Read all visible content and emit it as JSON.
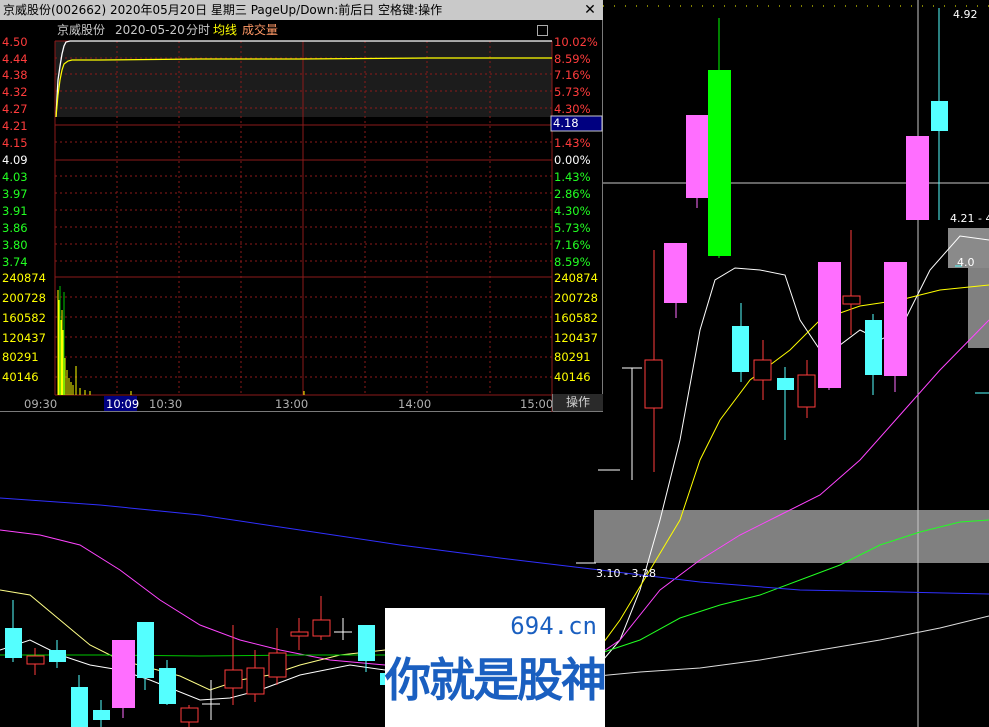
{
  "window": {
    "title": "京威股份(002662) 2020年05月20日 星期三 PageUp/Down:前后日 空格键:操作",
    "close_label": "✕"
  },
  "info_bar": {
    "name": "京威股份",
    "date": "2020-05-20",
    "tab_minute": "分时",
    "tab_avg": "均线",
    "tab_volume": "成交量"
  },
  "price_axis_left": [
    "4.50",
    "4.44",
    "4.38",
    "4.32",
    "4.27",
    "4.21",
    "4.15",
    "4.09",
    "4.03",
    "3.97",
    "3.91",
    "3.86",
    "3.80",
    "3.74"
  ],
  "pct_axis_right": [
    "10.02%",
    "8.59%",
    "7.16%",
    "5.73%",
    "4.30%",
    "",
    "1.43%",
    "0.00%",
    "1.43%",
    "2.86%",
    "4.30%",
    "5.73%",
    "7.16%",
    "8.59%"
  ],
  "current_price_tag": "4.18",
  "volume_axis": [
    "240874",
    "200728",
    "160582",
    "120437",
    "80291",
    "40146"
  ],
  "time_axis": [
    "09:30",
    "10:09",
    "10:30",
    "13:00",
    "14:00",
    "15:00"
  ],
  "operate_button": "操作",
  "main_chart": {
    "high_label": "4.92",
    "range_label_1": "4.21 - 4",
    "range_label_2": "4.0",
    "range_label_3": "3.10 - 3.28"
  },
  "watermark": {
    "site": "694.cn",
    "slogan": "你就是股神"
  },
  "colors": {
    "up": "#ff3c3c",
    "down": "#54ffff",
    "magenta_candle": "#ff6eff",
    "green_candle": "#00ff00",
    "price_line": "#ffffff",
    "avg_line": "#ffff00",
    "volume": "#ffff00"
  }
}
